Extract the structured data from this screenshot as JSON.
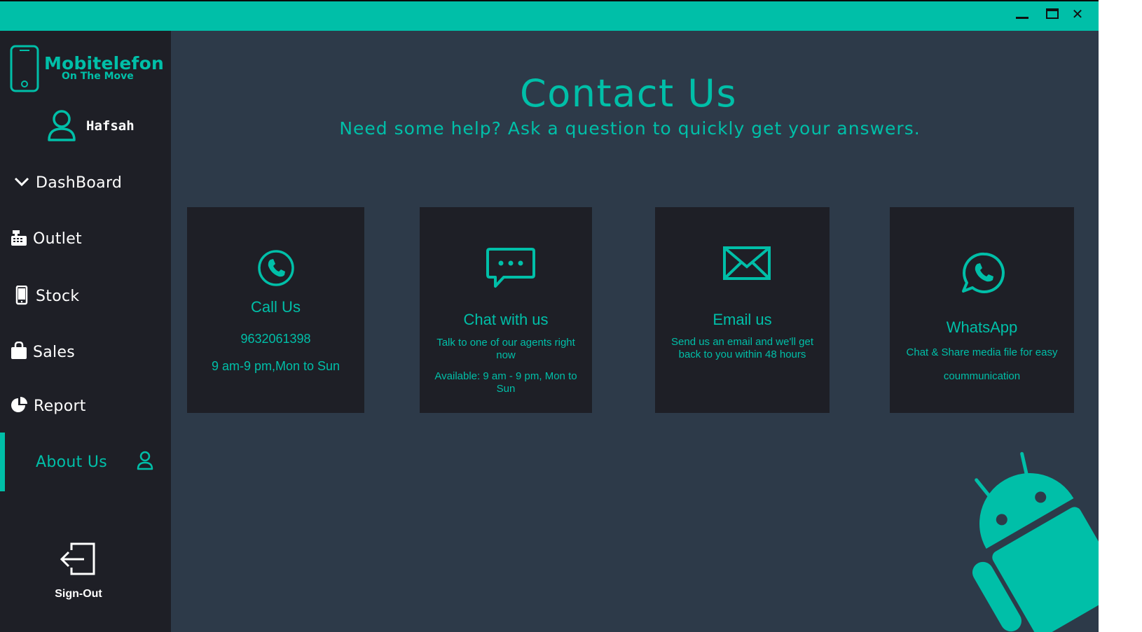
{
  "window": {
    "controls": {
      "minimize": "minimize",
      "maximize": "maximize",
      "close": "✕"
    }
  },
  "sidebar": {
    "brand": {
      "name": "Mobitelefon",
      "tagline": "On The Move"
    },
    "user": {
      "name": "Hafsah"
    },
    "nav": {
      "dashboard": "DashBoard",
      "outlet": "Outlet",
      "stock": "Stock",
      "sales": "Sales",
      "report": "Report",
      "about": "About Us"
    },
    "signout": "Sign-Out"
  },
  "main": {
    "title": "Contact Us",
    "subtitle": "Need some help? Ask a question to quickly get your answers.",
    "cards": {
      "call": {
        "title": "Call Us",
        "line1": "9632061398",
        "line2": "9 am-9 pm,Mon to Sun"
      },
      "chat": {
        "title": "Chat with us",
        "line1": "Talk to one of our agents right now",
        "line2": "Available: 9 am - 9 pm, Mon to Sun"
      },
      "email": {
        "title": "Email us",
        "line1": "Send us an email and we'll get back to you within 48 hours"
      },
      "whatsapp": {
        "title": "WhatsApp",
        "line1": "Chat & Share media file for easy",
        "line2": "coummunication"
      }
    }
  },
  "colors": {
    "accent": "#00bfa8",
    "panel": "#1e1f26",
    "background": "#2d3a49",
    "text": "#ffffff"
  },
  "icons": [
    "phone-icon",
    "chat-icon",
    "mail-icon",
    "whatsapp-icon",
    "user-icon",
    "chevron-down-icon",
    "cash-register-icon",
    "mobile-icon",
    "shopping-bag-icon",
    "pie-chart-icon",
    "sign-out-icon",
    "android-icon"
  ]
}
